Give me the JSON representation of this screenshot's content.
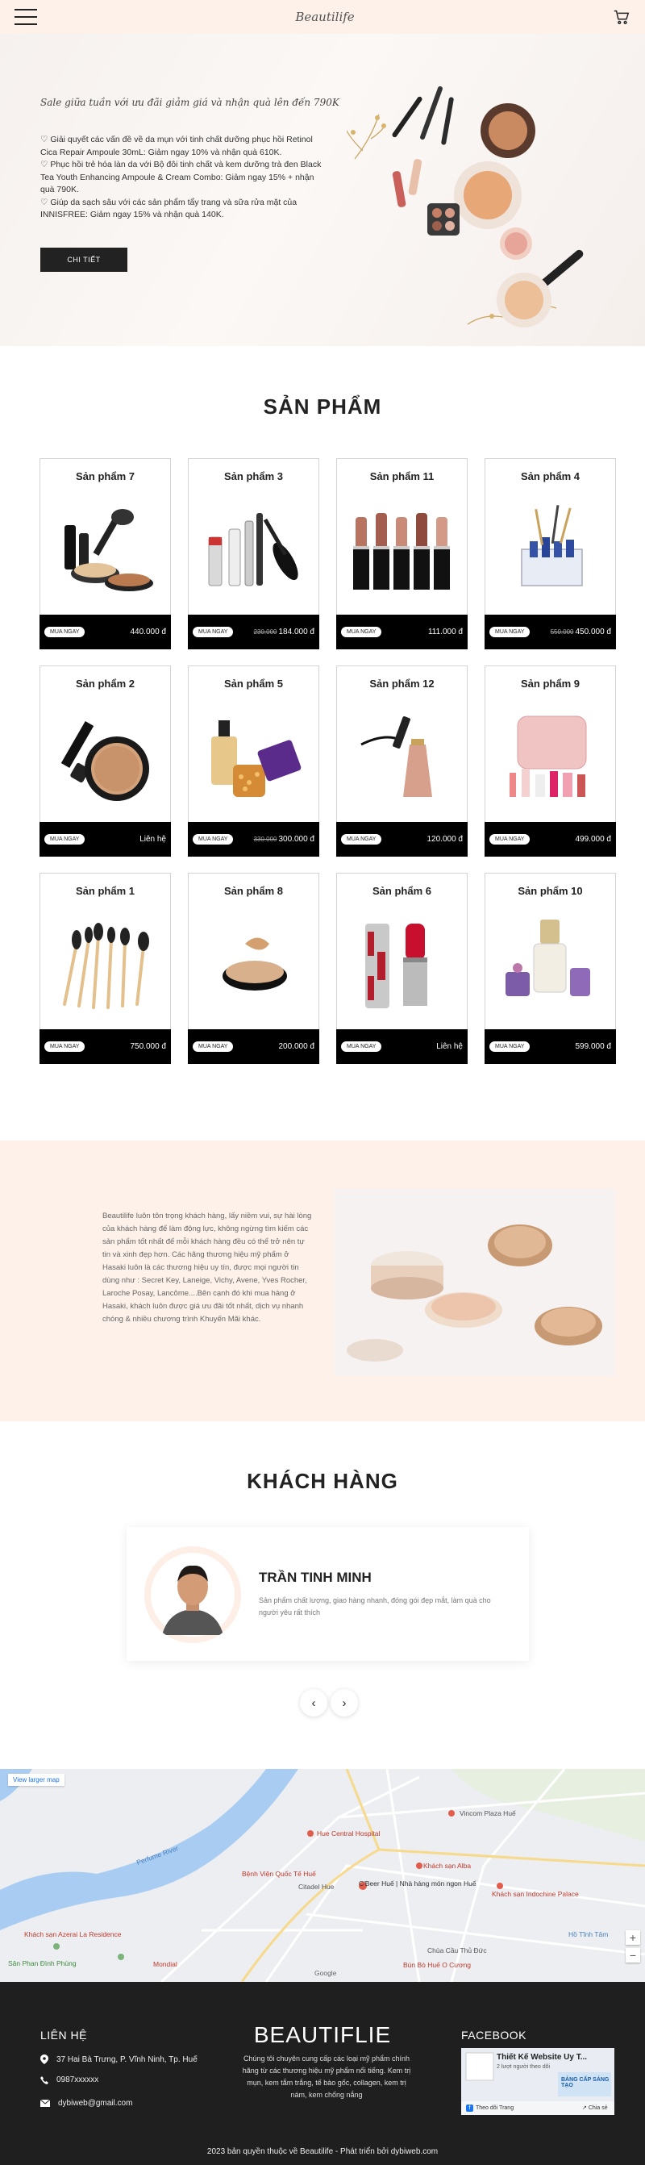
{
  "header": {
    "logo": "Beautilife"
  },
  "hero": {
    "tagline": "Sale giữa tuần với ưu đãi giảm giá và nhận quà lên đến 790K",
    "lines": [
      "♡ Giải quyết các vấn đề về da mụn với tinh chất dưỡng phục hồi Retinol Cica Repair Ampoule 30mL: Giảm ngay 10% và nhận quà 610K.",
      "♡ Phục hồi trẻ hóa làn da với Bộ đôi tinh chất và kem dưỡng trà đen Black Tea Youth Enhancing Ampoule & Cream Combo: Giảm ngay 15% + nhận quà 790K.",
      "♡ Giúp da sạch sâu với các sản phẩm tẩy trang và sữa rửa mặt của INNISFREE: Giảm ngay 15% và nhận quà 140K."
    ],
    "button": "CHI TIẾT"
  },
  "products_section": {
    "title": "SẢN PHẨM",
    "buy_label": "MUA NGAY",
    "items": [
      {
        "name": "Sản phẩm 7",
        "old_price": "",
        "price": "440.000 đ",
        "icon": "makeup-set-icon"
      },
      {
        "name": "Sản phẩm 3",
        "old_price": "230.000",
        "price": "184.000 đ",
        "icon": "mascara-icon"
      },
      {
        "name": "Sản phẩm 11",
        "old_price": "",
        "price": "111.000 đ",
        "icon": "lipstick-set-icon"
      },
      {
        "name": "Sản phẩm 4",
        "old_price": "550.000",
        "price": "450.000 đ",
        "icon": "organizer-icon"
      },
      {
        "name": "Sản phẩm 2",
        "old_price": "",
        "price": "Liên hệ",
        "icon": "compact-powder-icon"
      },
      {
        "name": "Sản phẩm 5",
        "old_price": "330.000",
        "price": "300.000 đ",
        "icon": "serum-icon"
      },
      {
        "name": "Sản phẩm 12",
        "old_price": "",
        "price": "120.000 đ",
        "icon": "eyeliner-icon"
      },
      {
        "name": "Sản phẩm 9",
        "old_price": "",
        "price": "499.000 đ",
        "icon": "cosmetic-bag-icon"
      },
      {
        "name": "Sản phẩm 1",
        "old_price": "",
        "price": "750.000 đ",
        "icon": "brush-set-icon"
      },
      {
        "name": "Sản phẩm 8",
        "old_price": "",
        "price": "200.000 đ",
        "icon": "compact-icon"
      },
      {
        "name": "Sản phẩm 6",
        "old_price": "",
        "price": "Liên hệ",
        "icon": "red-lipstick-icon"
      },
      {
        "name": "Sản phẩm 10",
        "old_price": "",
        "price": "599.000 đ",
        "icon": "perfume-icon"
      }
    ]
  },
  "about": {
    "text": "Beautilife luôn tôn trọng khách hàng, lấy niềm vui, sự hài lòng của khách hàng để làm động lực, không ngừng tìm kiếm các sản phẩm tốt nhất để mỗi khách hàng đều có thể trở nên tự tin và xinh đẹp hơn. Các hãng thương hiệu mỹ phẩm ở Hasaki luôn là các thương hiệu uy tín, được mọi người tin dùng như : Secret Key, Laneige, Vichy, Avene, Yves Rocher, Laroche Posay, Lancôme....Bên cạnh đó khi mua hàng ở Hasaki, khách luôn được giá ưu đãi tốt nhất, dịch vụ nhanh chóng & nhiều chương trình Khuyến Mãi khác."
  },
  "customers": {
    "title": "KHÁCH HÀNG",
    "name": "TRẦN TINH MINH",
    "text": "Sản phẩm chất lượng, giao hàng nhanh, đóng gói đẹp mắt, làm quà cho người yêu rất thích",
    "prev": "‹",
    "next": "›"
  },
  "map": {
    "link": "View larger map",
    "labels": [
      "Perfume River",
      "Hue Central Hospital",
      "Vincom Plaza Huế",
      "Khách sạn Alba",
      "Bệnh Viện Quốc Tế Huế",
      "Citadel Hue",
      "C'Beer Huế | Nhà hàng món ngon Huế",
      "Sân Phan Đình Phùng",
      "Mondial",
      "Chùa Cầu Thủ Đức",
      "Bún Bò Huế O Cương",
      "Khách sạn Indochine Palace",
      "Khách sạn Azerai La Residence",
      "Hồ Tĩnh Tâm",
      "Google"
    ]
  },
  "footer": {
    "contact_title": "LIÊN HỆ",
    "address": "37 Hai Bà Trưng, P. Vĩnh Ninh, Tp. Huế",
    "phone": "0987xxxxxx",
    "email": "dybiweb@gmail.com",
    "brand": "BEAUTIFLIE",
    "desc": "Chúng tôi chuyên cung cấp các loại mỹ phẩm chính hãng từ các thương hiệu mỹ phẩm nổi tiếng. Kem trị mụn, kem tắm trắng, tế bào gốc, collagen, kem trị nám, kem chống nắng",
    "fb_title": "FACEBOOK",
    "fb_page": "Thiết Kế Website Uy T...",
    "fb_followers": "2 lượt người theo dõi",
    "fb_follow": "Theo dõi Trang",
    "fb_share": "Chia sẻ",
    "fb_banner": "BẢNG CẤP SÁNG TẠO",
    "copyright": "2023 bản quyền thuộc về Beautilife - Phát triển bởi dybiweb.com"
  }
}
